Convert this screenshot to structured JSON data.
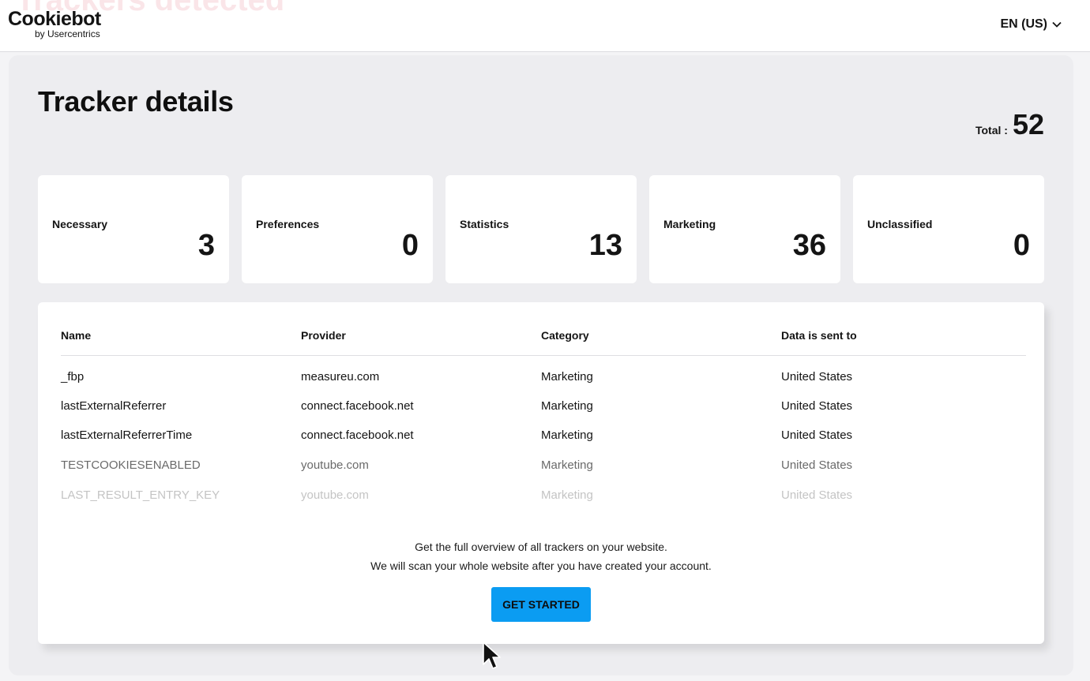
{
  "header": {
    "ghost_title": "Trackers detected",
    "logo": {
      "name": "Cookiebot",
      "tagline": "by Usercentrics"
    },
    "language": {
      "label": "EN (US)",
      "icon": "chevron-down-icon"
    }
  },
  "page": {
    "title": "Tracker details",
    "total_label": "Total :",
    "total_value": "52"
  },
  "categories": [
    {
      "label": "Necessary",
      "count": "3"
    },
    {
      "label": "Preferences",
      "count": "0"
    },
    {
      "label": "Statistics",
      "count": "13"
    },
    {
      "label": "Marketing",
      "count": "36"
    },
    {
      "label": "Unclassified",
      "count": "0"
    }
  ],
  "table": {
    "columns": [
      "Name",
      "Provider",
      "Category",
      "Data is sent to"
    ],
    "rows": [
      [
        "_fbp",
        "measureu.com",
        "Marketing",
        "United States"
      ],
      [
        "lastExternalReferrer",
        "connect.facebook.net",
        "Marketing",
        "United States"
      ],
      [
        "lastExternalReferrerTime",
        "connect.facebook.net",
        "Marketing",
        "United States"
      ],
      [
        "TESTCOOKIESENABLED",
        "youtube.com",
        "Marketing",
        "United States"
      ],
      [
        "LAST_RESULT_ENTRY_KEY",
        "youtube.com",
        "Marketing",
        "United States"
      ]
    ]
  },
  "cta": {
    "line1": "Get the full overview of all trackers on your website.",
    "line2": "We will scan your whole website after you have created your account.",
    "button_label": "GET STARTED"
  },
  "colors": {
    "accent_button": "#0b9cf2",
    "panel_background": "#ededf0"
  }
}
